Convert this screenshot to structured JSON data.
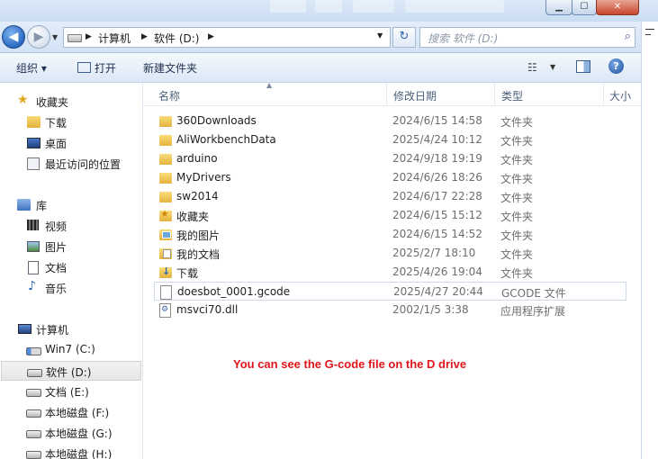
{
  "window": {
    "buttons": {
      "minimize": "▁",
      "maximize": "☐",
      "close": "✕"
    }
  },
  "navbar": {
    "back_glyph": "◀",
    "forward_glyph": "▶",
    "breadcrumbs": [
      "计算机",
      "软件 (D:)"
    ],
    "refresh_glyph": "↻",
    "search_placeholder": "搜索 软件 (D:)",
    "search_glyph": "⌕"
  },
  "toolbar": {
    "organize_label": "组织 ▾",
    "open_label": "打开",
    "new_folder_label": "新建文件夹",
    "view_glyph": "☷",
    "help_glyph": "?"
  },
  "sidebar": {
    "items": [
      {
        "label": "收藏夹",
        "icon": "star-icon"
      },
      {
        "label": "下载",
        "icon": "downloads-folder-icon"
      },
      {
        "label": "桌面",
        "icon": "desktop-icon"
      },
      {
        "label": "最近访问的位置",
        "icon": "recent-places-icon"
      },
      {
        "label": "库",
        "icon": "library-icon"
      },
      {
        "label": "视频",
        "icon": "video-icon"
      },
      {
        "label": "图片",
        "icon": "pictures-icon"
      },
      {
        "label": "文档",
        "icon": "documents-icon"
      },
      {
        "label": "音乐",
        "icon": "music-icon"
      },
      {
        "label": "计算机",
        "icon": "computer-icon"
      },
      {
        "label": "Win7 (C:)",
        "icon": "windows-drive-icon"
      },
      {
        "label": "软件 (D:)",
        "icon": "drive-icon",
        "selected": true
      },
      {
        "label": "文档 (E:)",
        "icon": "drive-icon"
      },
      {
        "label": "本地磁盘 (F:)",
        "icon": "drive-icon"
      },
      {
        "label": "本地磁盘 (G:)",
        "icon": "drive-icon"
      },
      {
        "label": "本地磁盘 (H:)",
        "icon": "drive-icon"
      }
    ]
  },
  "file_list": {
    "columns": [
      "名称",
      "修改日期",
      "类型",
      "大小"
    ],
    "rows": [
      {
        "name": "360Downloads",
        "date": "2024/6/15 14:58",
        "type": "文件夹",
        "icon": "folder-icon"
      },
      {
        "name": "AliWorkbenchData",
        "date": "2025/4/24 10:12",
        "type": "文件夹",
        "icon": "folder-icon"
      },
      {
        "name": "arduino",
        "date": "2024/9/18 19:19",
        "type": "文件夹",
        "icon": "folder-icon"
      },
      {
        "name": "MyDrivers",
        "date": "2024/6/26 18:26",
        "type": "文件夹",
        "icon": "folder-icon"
      },
      {
        "name": "sw2014",
        "date": "2024/6/17 22:28",
        "type": "文件夹",
        "icon": "folder-icon"
      },
      {
        "name": "收藏夹",
        "date": "2024/6/15 15:12",
        "type": "文件夹",
        "icon": "favorites-folder-icon"
      },
      {
        "name": "我的图片",
        "date": "2024/6/15 14:52",
        "type": "文件夹",
        "icon": "pictures-folder-icon"
      },
      {
        "name": "我的文档",
        "date": "2025/2/7 18:10",
        "type": "文件夹",
        "icon": "documents-folder-icon"
      },
      {
        "name": "下载",
        "date": "2025/4/26 19:04",
        "type": "文件夹",
        "icon": "downloads-folder-icon"
      },
      {
        "name": "doesbot_0001.gcode",
        "date": "2025/4/27 20:44",
        "type": "GCODE 文件",
        "icon": "file-icon",
        "selected": true
      },
      {
        "name": "msvci70.dll",
        "date": "2002/1/5 3:38",
        "type": "应用程序扩展",
        "icon": "dll-icon"
      }
    ]
  },
  "annotation": {
    "text": "You can see the G-code file on the D drive",
    "color": "#e0141a"
  }
}
